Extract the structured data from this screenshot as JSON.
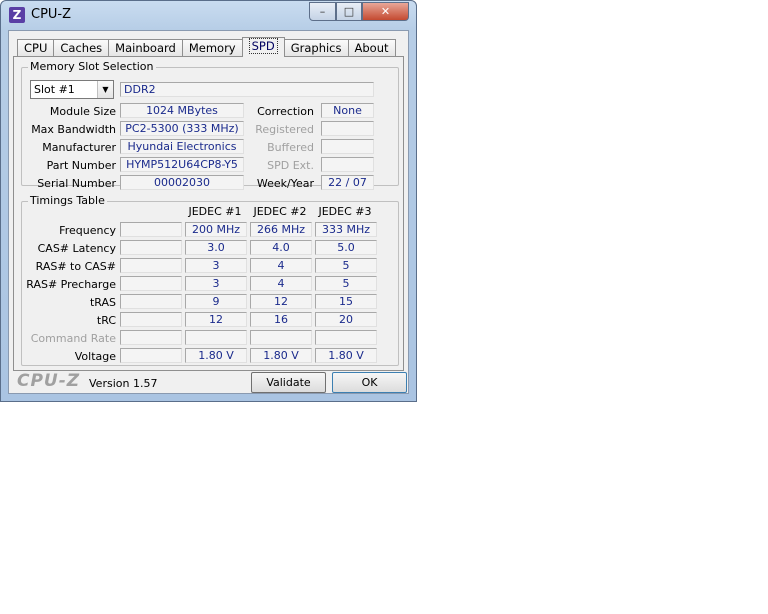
{
  "window": {
    "title": "CPU-Z",
    "icon_letter": "Z",
    "min": "–",
    "max": "□",
    "close": "✕"
  },
  "tabs": [
    "CPU",
    "Caches",
    "Mainboard",
    "Memory",
    "SPD",
    "Graphics",
    "About"
  ],
  "active_tab": "SPD",
  "slot": {
    "group_title": "Memory Slot Selection",
    "selected": "Slot #1",
    "type": "DDR2",
    "fields_left": [
      {
        "label": "Module Size",
        "value": "1024 MBytes"
      },
      {
        "label": "Max Bandwidth",
        "value": "PC2-5300 (333 MHz)"
      },
      {
        "label": "Manufacturer",
        "value": "Hyundai Electronics"
      },
      {
        "label": "Part Number",
        "value": "HYMP512U64CP8-Y5"
      },
      {
        "label": "Serial Number",
        "value": "00002030"
      }
    ],
    "fields_right": [
      {
        "label": "Correction",
        "value": "None",
        "dim": false
      },
      {
        "label": "Registered",
        "value": "",
        "dim": true
      },
      {
        "label": "Buffered",
        "value": "",
        "dim": true
      },
      {
        "label": "SPD Ext.",
        "value": "",
        "dim": true
      },
      {
        "label": "Week/Year",
        "value": "22 / 07",
        "dim": false
      }
    ]
  },
  "timings": {
    "group_title": "Timings Table",
    "columns": [
      "JEDEC #1",
      "JEDEC #2",
      "JEDEC #3"
    ],
    "rows": [
      {
        "label": "Frequency",
        "values": [
          "200 MHz",
          "266 MHz",
          "333 MHz"
        ],
        "dim": false
      },
      {
        "label": "CAS# Latency",
        "values": [
          "3.0",
          "4.0",
          "5.0"
        ],
        "dim": false
      },
      {
        "label": "RAS# to CAS#",
        "values": [
          "3",
          "4",
          "5"
        ],
        "dim": false
      },
      {
        "label": "RAS# Precharge",
        "values": [
          "3",
          "4",
          "5"
        ],
        "dim": false
      },
      {
        "label": "tRAS",
        "values": [
          "9",
          "12",
          "15"
        ],
        "dim": false
      },
      {
        "label": "tRC",
        "values": [
          "12",
          "16",
          "20"
        ],
        "dim": false
      },
      {
        "label": "Command Rate",
        "values": [
          "",
          "",
          ""
        ],
        "dim": true
      },
      {
        "label": "Voltage",
        "values": [
          "1.80 V",
          "1.80 V",
          "1.80 V"
        ],
        "dim": false
      }
    ]
  },
  "footer": {
    "logo": "CPU-Z",
    "version": "Version 1.57",
    "validate": "Validate",
    "ok": "OK"
  }
}
